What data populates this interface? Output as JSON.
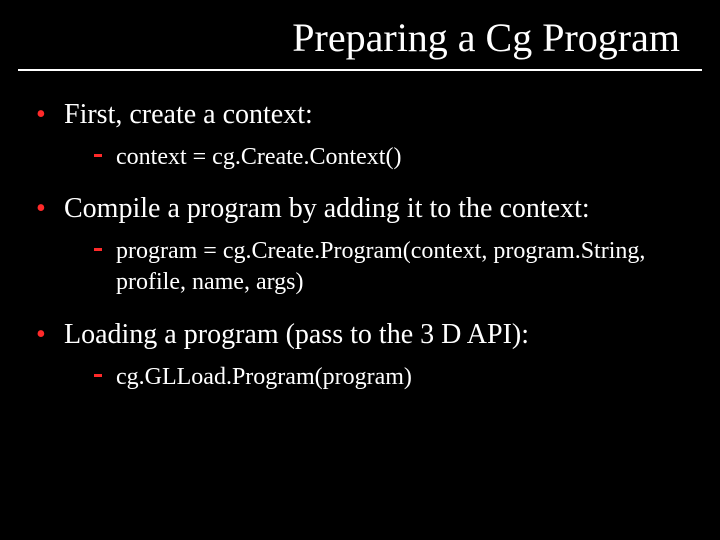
{
  "title": "Preparing a Cg Program",
  "bullets": [
    {
      "text": "First, create a context:",
      "sub": [
        "context = cg.Create.Context()"
      ]
    },
    {
      "text": "Compile a program by adding it to the context:",
      "sub": [
        "program = cg.Create.Program(context, program.String, profile, name, args)"
      ]
    },
    {
      "text": "Loading a program (pass to the 3 D API):",
      "sub": [
        "cg.GLLoad.Program(program)"
      ]
    }
  ]
}
